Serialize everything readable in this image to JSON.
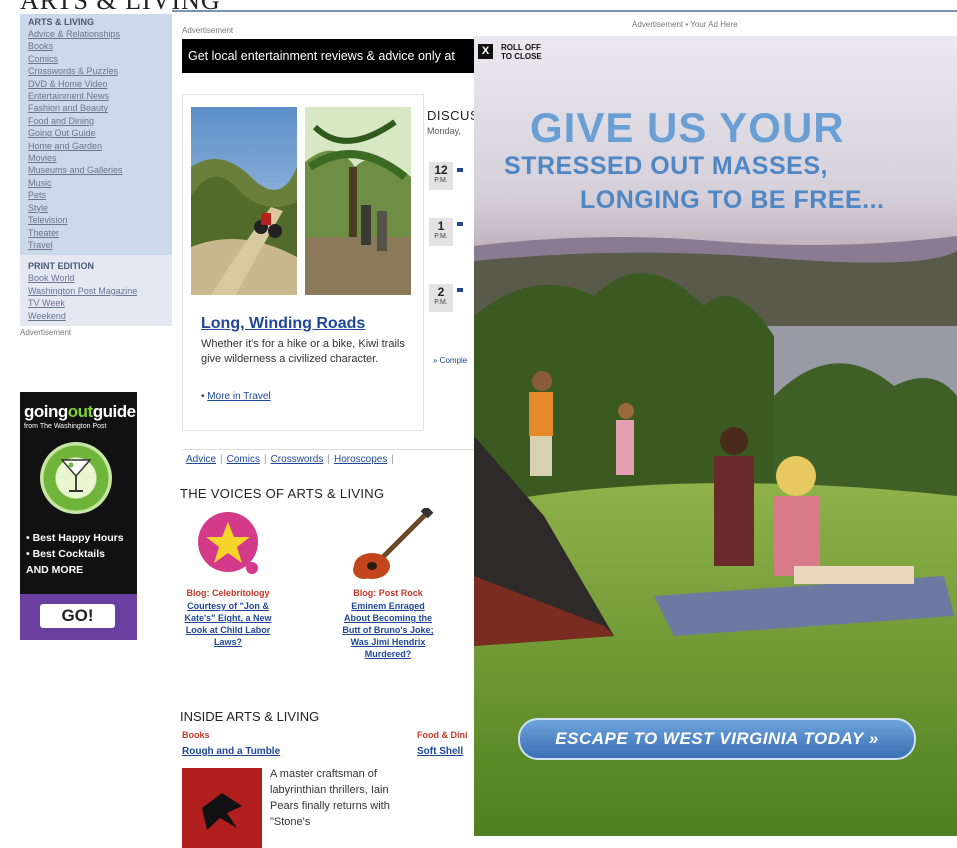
{
  "masthead": "ARTS & LIVING",
  "sidebar": {
    "heading": "ARTS & LIVING",
    "items": [
      "Advice & Relationships",
      "Books",
      "Comics",
      "Crosswords & Puzzles",
      "DVD & Home Video",
      "Entertainment News",
      "Fashion and Beauty",
      "Food and Dining",
      "Going Out Guide",
      "Home and Garden",
      "Movies",
      "Museums and Galleries",
      "Music",
      "Pets",
      "Style",
      "Television",
      "Theater",
      "Travel"
    ],
    "print_heading": "PRINT EDITION",
    "print_items": [
      "Book World",
      "Washington Post Magazine",
      "TV Week",
      "Weekend"
    ],
    "ad_label": "Advertisement"
  },
  "goguide": {
    "logo_a": "going",
    "logo_b": "out",
    "logo_c": "guide",
    "from": "from The Washington Post",
    "bullets": [
      "• Best Happy Hours",
      "• Best Cocktails",
      "AND MORE"
    ],
    "go": "GO!"
  },
  "main": {
    "ad_label": "Advertisement",
    "banner": "Get local entertainment reviews & advice only at",
    "feature": {
      "title": "Long, Winding Roads",
      "desc": "Whether it's for a hike or a bike, Kiwi trails give wilderness a civilized character.",
      "more_bullet": "•",
      "more": "More in Travel"
    },
    "discussions": {
      "title": "DISCUS",
      "date": "Monday,",
      "slots": [
        {
          "num": "12",
          "ampm": "P.M."
        },
        {
          "num": "1",
          "ampm": "P.M."
        },
        {
          "num": "2",
          "ampm": "P.M."
        }
      ],
      "complete": "» Comple"
    },
    "links": [
      "Advice",
      "Comics",
      "Crosswords",
      "Horoscopes"
    ],
    "voices": {
      "title": "THE VOICES OF ARTS & LIVING",
      "items": [
        {
          "category": "Blog: Celebritology",
          "title": "Courtesy of \"Jon & Kate's\" Eight, a New Look at Child Labor Laws?"
        },
        {
          "category": "Blog: Post Rock",
          "title": "Eminem Enraged About Becoming the Butt of Bruno's Joke; Was Jimi Hendrix Murdered?"
        }
      ]
    },
    "inside": {
      "title": "INSIDE ARTS & LIVING",
      "books_cat": "Books",
      "books_title": "Rough and a Tumble",
      "books_text": "A master craftsman of labyrinthian thrillers, Iain Pears finally returns with \"Stone's",
      "food_cat": "Food & Dini",
      "food_title": "Soft Shell"
    }
  },
  "ad": {
    "top_label": "Advertisement • Your Ad Here",
    "close_x": "X",
    "close_line1": "ROLL OFF",
    "close_line2": "TO CLOSE",
    "h1": "GIVE US YOUR",
    "h2": "STRESSED OUT MASSES,",
    "h3": "LONGING TO BE FREE...",
    "cta": "ESCAPE TO WEST VIRGINIA TODAY »"
  }
}
